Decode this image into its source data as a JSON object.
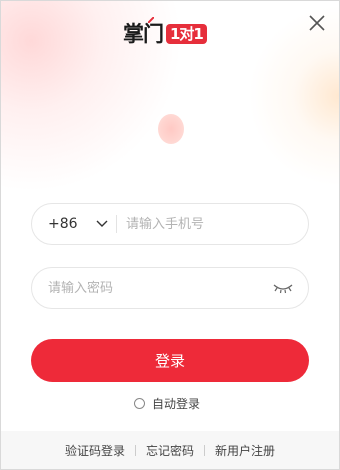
{
  "app": {
    "logo_text": "掌门",
    "logo_badge": "1对1",
    "brand_color": "#ee2a39"
  },
  "window": {
    "close_icon": "close-icon"
  },
  "login_form": {
    "country_code": "+86",
    "phone_placeholder": "请输入手机号",
    "password_placeholder": "请输入密码",
    "eye_icon": "eye-closed-icon",
    "submit_label": "登录",
    "auto_login_label": "自动登录",
    "auto_login_checked": false
  },
  "footer": {
    "links": [
      {
        "label": "验证码登录"
      },
      {
        "label": "忘记密码"
      },
      {
        "label": "新用户注册"
      }
    ]
  }
}
